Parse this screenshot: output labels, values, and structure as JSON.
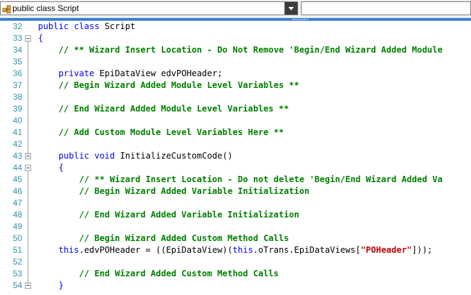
{
  "toolbar": {
    "class_combo_value": "public class Script",
    "class_icon": "class-icon",
    "member_combo_value": ""
  },
  "editor": {
    "lines": [
      {
        "num": "32",
        "fold": false,
        "segments": [
          [
            "kw",
            "public "
          ],
          [
            "kw",
            "class "
          ],
          [
            "tx",
            "Script"
          ]
        ]
      },
      {
        "num": "33",
        "fold": true,
        "segments": [
          [
            "kw",
            "{"
          ]
        ]
      },
      {
        "num": "34",
        "fold": false,
        "segments": [
          [
            "tx",
            "    "
          ],
          [
            "cm",
            "// ** Wizard Insert Location - Do Not Remove 'Begin/End Wizard Added Module"
          ]
        ]
      },
      {
        "num": "35",
        "fold": false,
        "segments": []
      },
      {
        "num": "36",
        "fold": false,
        "segments": [
          [
            "tx",
            "    "
          ],
          [
            "kw",
            "private "
          ],
          [
            "tx",
            "EpiDataView edvPOHeader;"
          ]
        ]
      },
      {
        "num": "37",
        "fold": false,
        "segments": [
          [
            "tx",
            "    "
          ],
          [
            "cm",
            "// Begin Wizard Added Module Level Variables **"
          ]
        ]
      },
      {
        "num": "38",
        "fold": false,
        "segments": []
      },
      {
        "num": "39",
        "fold": false,
        "segments": [
          [
            "tx",
            "    "
          ],
          [
            "cm",
            "// End Wizard Added Module Level Variables **"
          ]
        ]
      },
      {
        "num": "40",
        "fold": false,
        "segments": []
      },
      {
        "num": "41",
        "fold": false,
        "segments": [
          [
            "tx",
            "    "
          ],
          [
            "cm",
            "// Add Custom Module Level Variables Here **"
          ]
        ]
      },
      {
        "num": "42",
        "fold": false,
        "segments": []
      },
      {
        "num": "43",
        "fold": true,
        "segments": [
          [
            "tx",
            "    "
          ],
          [
            "kw",
            "public "
          ],
          [
            "kw",
            "void "
          ],
          [
            "tx",
            "InitializeCustomCode()"
          ]
        ]
      },
      {
        "num": "44",
        "fold": true,
        "segments": [
          [
            "tx",
            "    "
          ],
          [
            "kw",
            "{"
          ]
        ]
      },
      {
        "num": "45",
        "fold": false,
        "segments": [
          [
            "tx",
            "        "
          ],
          [
            "cm",
            "// ** Wizard Insert Location - Do not delete 'Begin/End Wizard Added Va"
          ]
        ]
      },
      {
        "num": "46",
        "fold": false,
        "segments": [
          [
            "tx",
            "        "
          ],
          [
            "cm",
            "// Begin Wizard Added Variable Initialization"
          ]
        ]
      },
      {
        "num": "47",
        "fold": false,
        "segments": []
      },
      {
        "num": "48",
        "fold": false,
        "segments": [
          [
            "tx",
            "        "
          ],
          [
            "cm",
            "// End Wizard Added Variable Initialization"
          ]
        ]
      },
      {
        "num": "49",
        "fold": false,
        "segments": []
      },
      {
        "num": "50",
        "fold": false,
        "segments": [
          [
            "tx",
            "        "
          ],
          [
            "cm",
            "// Begin Wizard Added Custom Method Calls"
          ]
        ]
      },
      {
        "num": "51",
        "fold": false,
        "segments": [
          [
            "tx",
            "    "
          ],
          [
            "kw",
            "this"
          ],
          [
            "tx",
            ".edvPOHeader = ((EpiDataView)("
          ],
          [
            "kw",
            "this"
          ],
          [
            "tx",
            ".oTrans.EpiDataViews["
          ],
          [
            "st",
            "\"POHeader\""
          ],
          [
            "tx",
            "]));"
          ]
        ]
      },
      {
        "num": "52",
        "fold": false,
        "segments": []
      },
      {
        "num": "53",
        "fold": false,
        "segments": [
          [
            "tx",
            "        "
          ],
          [
            "cm",
            "// End Wizard Added Custom Method Calls"
          ]
        ]
      },
      {
        "num": "54",
        "fold": true,
        "segments": [
          [
            "tx",
            "    "
          ],
          [
            "kw",
            "}"
          ]
        ]
      }
    ]
  },
  "colors": {
    "keyword": "#0000ff",
    "comment": "#008000",
    "string": "#c00000",
    "line_number": "#2b91af",
    "accent_strip": "#3a7fd5"
  }
}
